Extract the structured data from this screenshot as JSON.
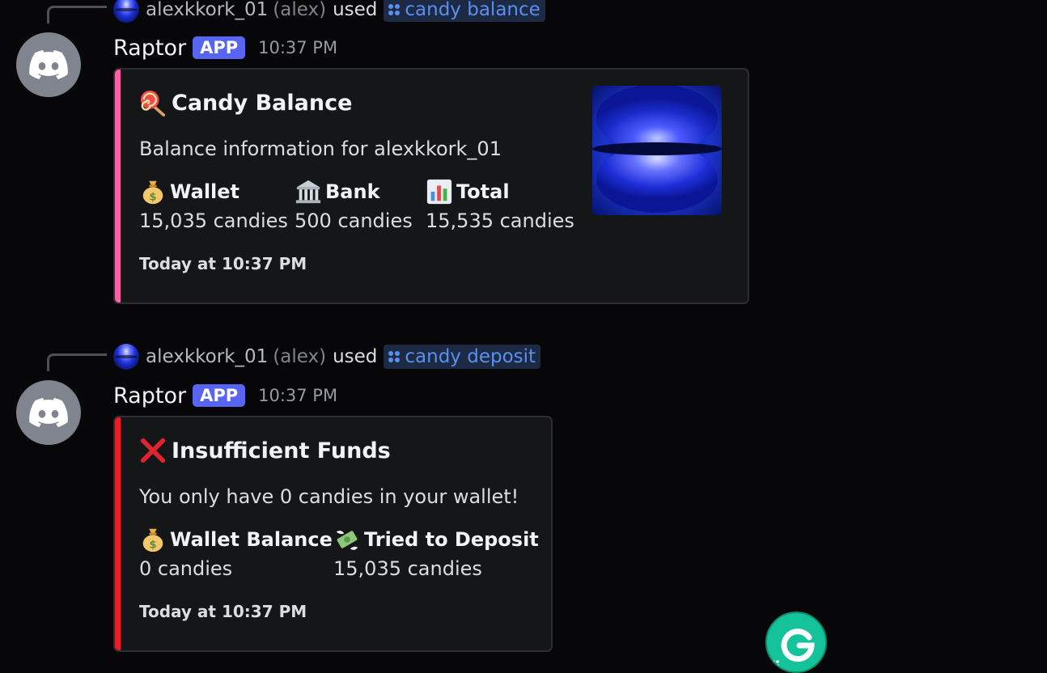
{
  "messages": [
    {
      "reply": {
        "user": "alexkkork_01",
        "handle": "(alex)",
        "used": "used",
        "command": "candy balance"
      },
      "author": "Raptor",
      "badge": "APP",
      "time": "10:37 PM",
      "embed": {
        "accent_color": "#ff5fa5",
        "title_icon": "lollipop-icon",
        "title": "Candy Balance",
        "description": "Balance information for alexkkork_01",
        "fields": [
          {
            "icon": "money-bag-icon",
            "name": "Wallet",
            "value": "15,035 candies"
          },
          {
            "icon": "bank-icon",
            "name": "Bank",
            "value": "500 candies"
          },
          {
            "icon": "bar-chart-icon",
            "name": "Total",
            "value": "15,535 candies"
          }
        ],
        "footer": "Today at 10:37 PM",
        "has_thumbnail": true
      }
    },
    {
      "reply": {
        "user": "alexkkork_01",
        "handle": "(alex)",
        "used": "used",
        "command": "candy deposit"
      },
      "author": "Raptor",
      "badge": "APP",
      "time": "10:37 PM",
      "embed": {
        "accent_color": "#ed1c24",
        "title_icon": "red-x-icon",
        "title": "Insufficient Funds",
        "description": "You only have 0 candies in your wallet!",
        "fields": [
          {
            "icon": "money-bag-icon",
            "name": "Wallet Balance",
            "value": "0 candies"
          },
          {
            "icon": "money-with-wings-icon",
            "name": "Tried to Deposit",
            "value": "15,035 candies"
          }
        ],
        "footer": "Today at 10:37 PM",
        "has_thumbnail": false
      }
    }
  ],
  "colors": {
    "background": "#070709",
    "embed_background": "#151618",
    "app_badge": "#5865f2",
    "command_link": "#5a8ff0",
    "grammarly_green": "#15c39a"
  },
  "grammarly": {
    "icon": "grammarly-g-icon"
  }
}
